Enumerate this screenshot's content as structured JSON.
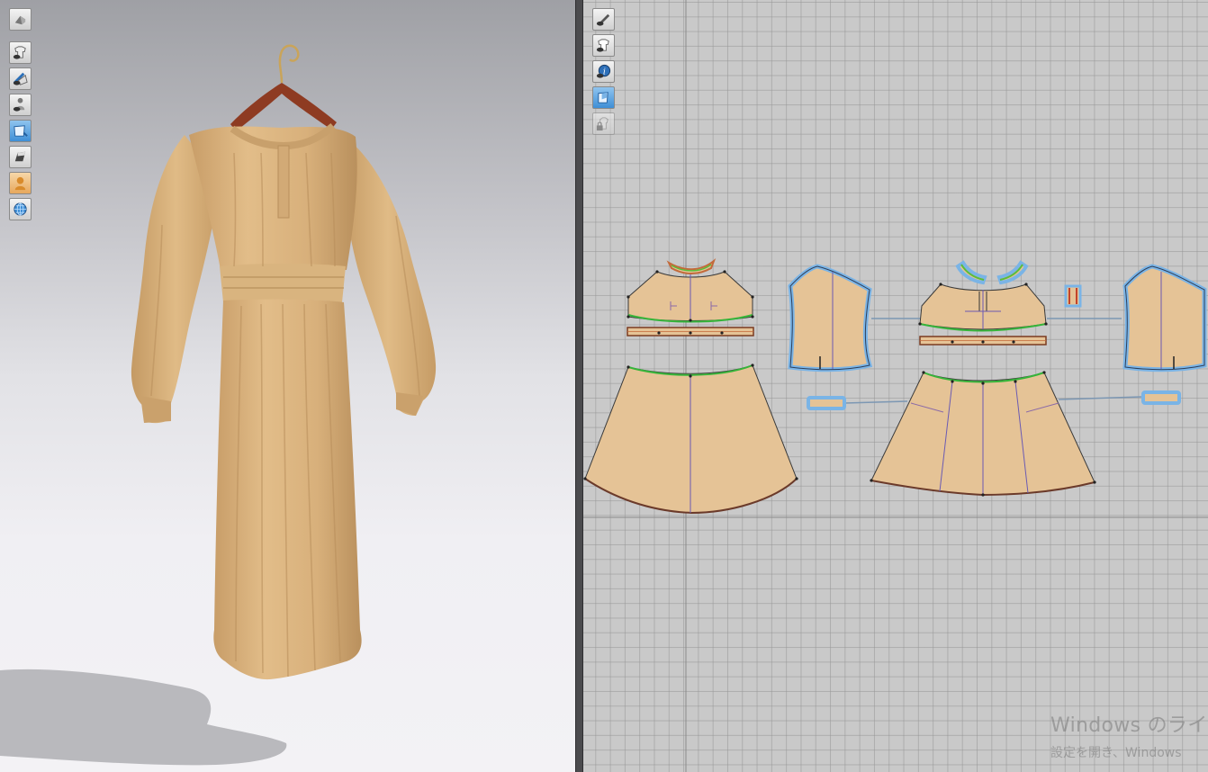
{
  "viewport_3d": {
    "toolbar": [
      {
        "icon": "avatar-display-icon"
      },
      {
        "icon": "garment-visibility-icon"
      },
      {
        "icon": "texture-surface-icon"
      },
      {
        "icon": "avatar-visibility-icon"
      },
      {
        "icon": "fabric-render-icon"
      },
      {
        "icon": "thickness-icon"
      },
      {
        "icon": "skin-shading-icon"
      },
      {
        "icon": "environment-globe-icon"
      }
    ],
    "colors": {
      "fabric": "#dcb37f",
      "fabric_shadow": "#b98f5c",
      "hanger": "#8e3b22",
      "hook": "#c9a45a",
      "floor_shadow": "#b9b9bd"
    }
  },
  "viewport_2d": {
    "toolbar": [
      {
        "icon": "pattern-pen-icon"
      },
      {
        "icon": "garment-show-icon"
      },
      {
        "icon": "pattern-info-icon"
      },
      {
        "icon": "texture-2d-icon"
      },
      {
        "icon": "lock-garment-icon"
      }
    ],
    "colors": {
      "pattern_fill": "#e5c396",
      "seam_selected": "#7ab4e6",
      "sewing_line": "#36b43a",
      "outline": "#3a3a3a",
      "grid": "#c9c9c9"
    }
  },
  "watermark": {
    "title": "Windows のライセ",
    "subtitle": "設定を開き、Windows"
  }
}
